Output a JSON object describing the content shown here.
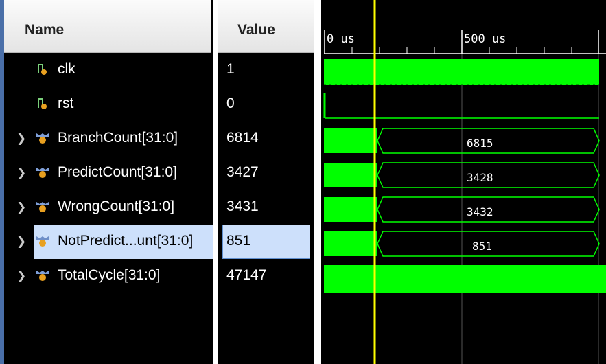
{
  "columns": {
    "name": "Name",
    "value": "Value"
  },
  "signals": [
    {
      "name": "clk",
      "value": "1",
      "kind": "bit",
      "expandable": false
    },
    {
      "name": "rst",
      "value": "0",
      "kind": "bit",
      "expandable": false
    },
    {
      "name": "BranchCount[31:0]",
      "value": "6814",
      "kind": "bus",
      "expandable": true,
      "bus_value_after_cursor": "6815"
    },
    {
      "name": "PredictCount[31:0]",
      "value": "3427",
      "kind": "bus",
      "expandable": true,
      "bus_value_after_cursor": "3428"
    },
    {
      "name": "WrongCount[31:0]",
      "value": "3431",
      "kind": "bus",
      "expandable": true,
      "bus_value_after_cursor": "3432"
    },
    {
      "name": "NotPredict...unt[31:0]",
      "value": "851",
      "kind": "bus",
      "expandable": true,
      "selected": true,
      "bus_value_after_cursor": "851"
    },
    {
      "name": "TotalCycle[31:0]",
      "value": "47147",
      "kind": "bus",
      "expandable": true
    }
  ],
  "timeline": {
    "tick_labels": [
      "0 us",
      "500 us"
    ]
  },
  "colors": {
    "wave": "#00ff00",
    "cursor": "#ffff00",
    "selection": "#cde0fb",
    "background": "#000000"
  },
  "icons": {
    "bit_signal": "bit-signal-icon",
    "bus_signal": "bus-signal-icon",
    "expander": "chevron-right-icon"
  }
}
